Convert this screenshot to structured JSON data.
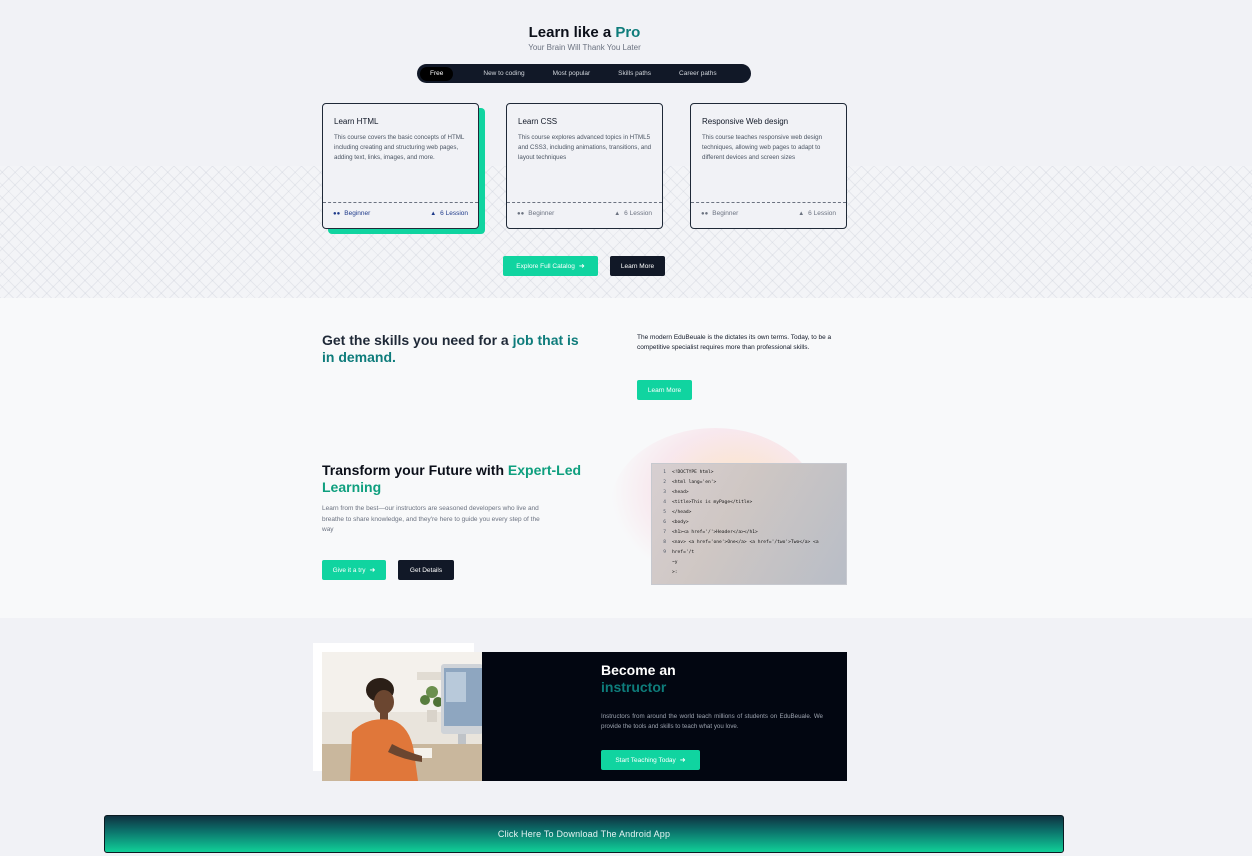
{
  "hero": {
    "title_prefix": "Learn like a",
    "title_accent": "Pro",
    "subtitle": "Your Brain Will Thank You Later"
  },
  "tabs": [
    "Free",
    "New to coding",
    "Most popular",
    "Skills paths",
    "Career paths"
  ],
  "courses": [
    {
      "title": "Learn HTML",
      "description": "This course covers the basic concepts of HTML including creating and structuring web pages, adding text, links, images, and more.",
      "level": "Beginner",
      "lessons": "6 Lession"
    },
    {
      "title": "Learn CSS",
      "description": "This course explores advanced topics in HTML5 and CSS3, including animations, transitions, and layout techniques",
      "level": "Beginner",
      "lessons": "6 Lession"
    },
    {
      "title": "Responsive Web design",
      "description": "This course teaches responsive web design techniques, allowing web pages to adapt to different devices and screen sizes",
      "level": "Beginner",
      "lessons": "6 Lession"
    }
  ],
  "catalog": {
    "explore_label": "Explore Full Catalog",
    "learn_more_label": "Learn More"
  },
  "skills": {
    "title_prefix": "Get the skills you need for a",
    "title_accent": "job that is in demand.",
    "text": "The modern EduBeuale is the dictates its own terms. Today, to be a competitive specialist requires more than professional skills.",
    "button_label": "Learn More"
  },
  "transform": {
    "title_prefix": "Transform your Future with",
    "title_accent": "Expert-Led Learning",
    "text": "Learn from the best—our instructors are seasoned developers who live and breathe to share knowledge, and they're here to guide you every step of the way",
    "primary_label": "Give it a try",
    "secondary_label": "Get Details"
  },
  "code": [
    {
      "n": "1",
      "text": "<!DOCTYPE html>"
    },
    {
      "n": "2",
      "text": "<html lang='en'>"
    },
    {
      "n": "3",
      "text": "<head>"
    },
    {
      "n": "4",
      "text": "<title>This is myPage</title>"
    },
    {
      "n": "5",
      "text": "</head>"
    },
    {
      "n": "6",
      "text": "<body>"
    },
    {
      "n": "7",
      "text": "<h1><a href='/'>Header</a></h1>"
    },
    {
      "n": "8",
      "text": "<nav> <a href='one'>One</a> <a href='/two'>Two</a> <a"
    },
    {
      "n": "9",
      "text": "href='/t"
    },
    {
      "n": "",
      "text": "~y"
    },
    {
      "n": "",
      "text": ">:"
    }
  ],
  "instructor": {
    "title_prefix": "Become an",
    "title_accent": "instructor",
    "text": "Instructors from around the world teach millions of students on EduBeuale. We provide the tools and skills to teach what you love.",
    "button_label": "Start Teaching Today"
  },
  "download": {
    "label": "Click Here To Download The Android App"
  },
  "icons": {
    "arrow": "arrow-right-icon",
    "level": "users-icon",
    "lessons": "layers-icon"
  },
  "colors": {
    "accent_green": "#10d4a0",
    "accent_teal": "#0e7c7b",
    "dark": "#111827"
  }
}
